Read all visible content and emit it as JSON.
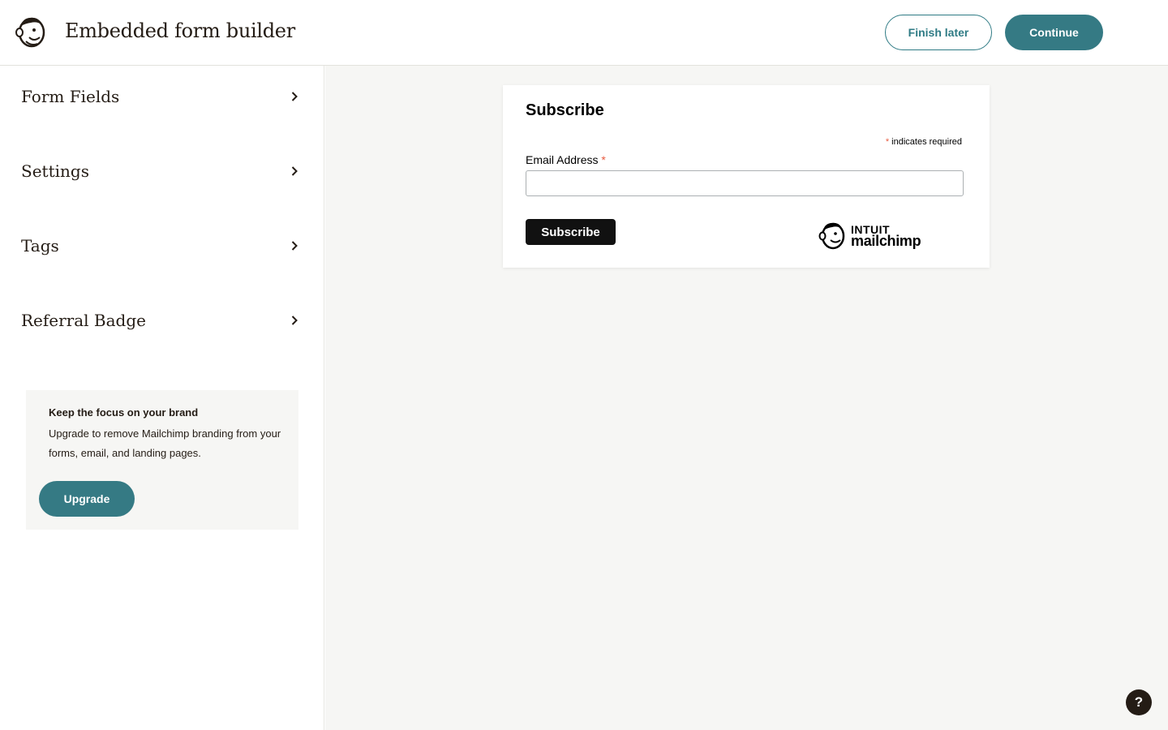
{
  "header": {
    "logo_icon": "mailchimp-freddie-logo",
    "title": "Embedded form builder",
    "finish_later_label": "Finish later",
    "continue_label": "Continue"
  },
  "sidebar": {
    "items": [
      {
        "label": "Form Fields",
        "icon": "chevron-right-icon"
      },
      {
        "label": "Settings",
        "icon": "chevron-right-icon"
      },
      {
        "label": "Tags",
        "icon": "chevron-right-icon"
      },
      {
        "label": "Referral Badge",
        "icon": "chevron-right-icon"
      }
    ],
    "promo": {
      "title": "Keep the focus on your brand",
      "description": "Upgrade to remove Mailchimp branding from your forms, email, and landing pages.",
      "button_label": "Upgrade"
    }
  },
  "form": {
    "title": "Subscribe",
    "required_star": "*",
    "required_note": "indicates required",
    "email_label": "Email Address",
    "email_value": "",
    "submit_label": "Subscribe",
    "brand_line1": "INTUIT",
    "brand_line2": "mailchimp"
  },
  "help": {
    "label": "?"
  },
  "colors": {
    "accent": "#357a84",
    "canvas_bg": "#f6f6f4",
    "required": "#e85c41",
    "text": "#241c15"
  }
}
